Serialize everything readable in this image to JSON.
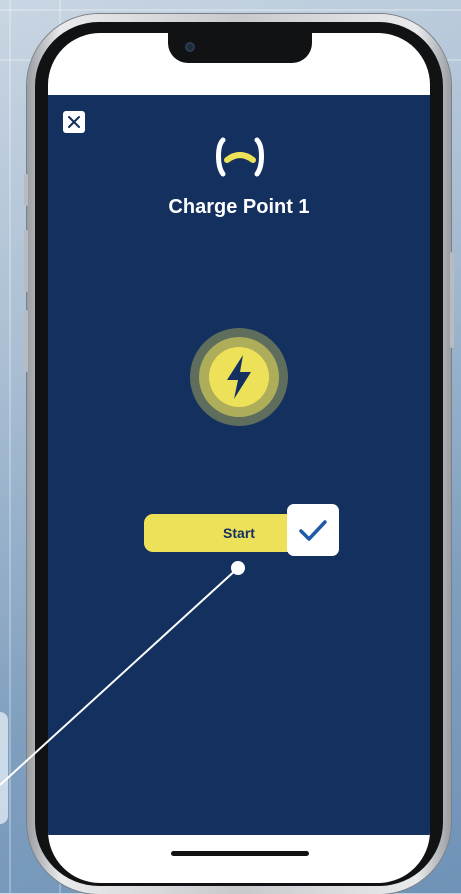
{
  "app": {
    "title": "Charge Point 1",
    "start_label": "Start",
    "background_color": "#13305f",
    "accent_color": "#ede15a"
  },
  "icons": {
    "close": "close-icon",
    "logo": "brand-logo-icon",
    "charging": "lightning-bolt-icon",
    "confirm": "checkmark-icon"
  }
}
